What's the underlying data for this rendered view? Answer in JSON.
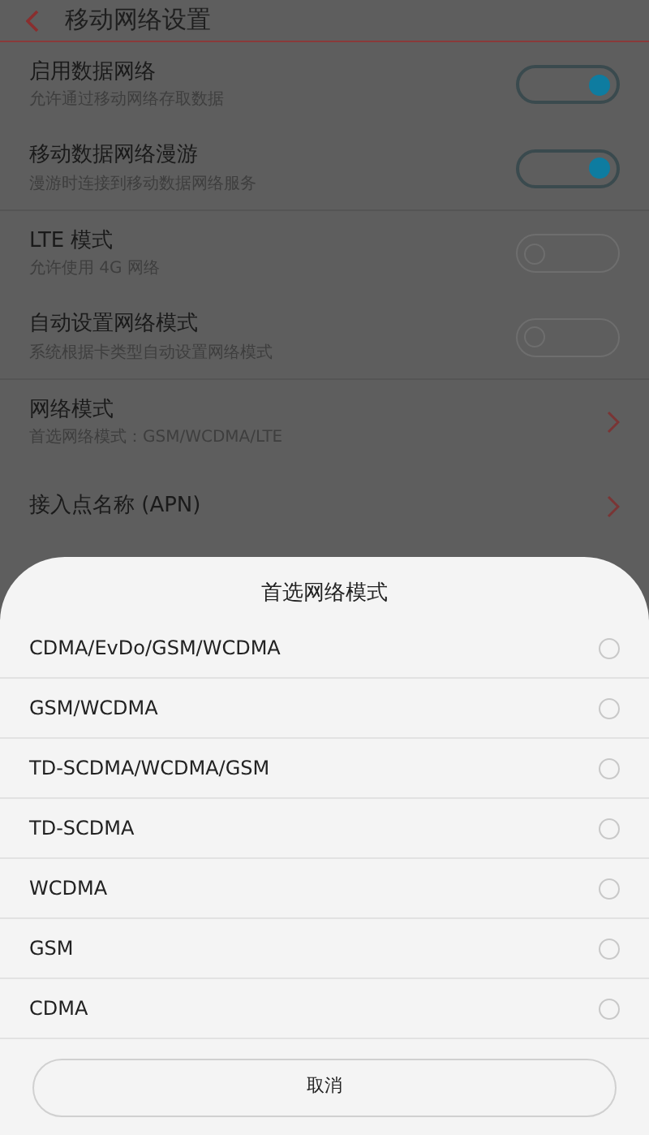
{
  "header": {
    "title": "移动网络设置"
  },
  "settings": [
    {
      "kind": "toggle",
      "title": "启用数据网络",
      "subtitle": "允许通过移动网络存取数据",
      "on": true
    },
    {
      "kind": "toggle",
      "title": "移动数据网络漫游",
      "subtitle": "漫游时连接到移动数据网络服务",
      "on": true
    },
    {
      "kind": "toggle",
      "title": "LTE 模式",
      "subtitle": "允许使用 4G 网络",
      "on": false
    },
    {
      "kind": "toggle",
      "title": "自动设置网络模式",
      "subtitle": "系统根据卡类型自动设置网络模式",
      "on": false
    },
    {
      "kind": "link",
      "title": "网络模式",
      "subtitle": "首选网络模式：GSM/WCDMA/LTE"
    },
    {
      "kind": "link",
      "title": "接入点名称 (APN)"
    }
  ],
  "sheet": {
    "title": "首选网络模式",
    "options": [
      {
        "label": "CDMA/EvDo/GSM/WCDMA",
        "selected": false
      },
      {
        "label": "GSM/WCDMA",
        "selected": false
      },
      {
        "label": "TD-SCDMA/WCDMA/GSM",
        "selected": false
      },
      {
        "label": "TD-SCDMA",
        "selected": false
      },
      {
        "label": "WCDMA",
        "selected": false
      },
      {
        "label": "GSM",
        "selected": false
      },
      {
        "label": "CDMA",
        "selected": false
      }
    ],
    "cancel": "取消"
  }
}
